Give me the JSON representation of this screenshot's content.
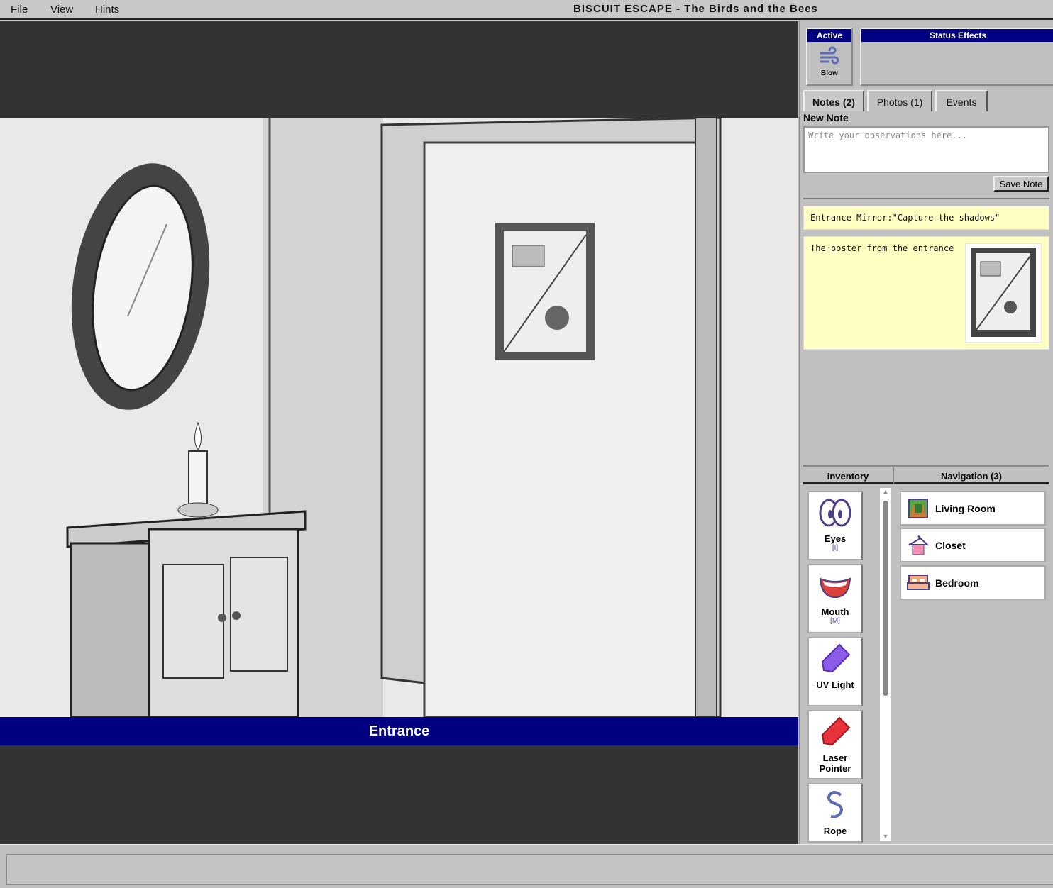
{
  "menu": {
    "items": [
      "File",
      "View",
      "Hints"
    ]
  },
  "window": {
    "title": "BISCUIT ESCAPE - The Birds and the Bees"
  },
  "scene": {
    "location": "Entrance"
  },
  "active": {
    "header": "Active",
    "items": [
      {
        "label": "Blow",
        "icon": "wind-icon"
      }
    ]
  },
  "status": {
    "header": "Status Effects"
  },
  "tabs": [
    {
      "label": "Notes (2)",
      "active": true
    },
    {
      "label": "Photos (1)"
    },
    {
      "label": "Events"
    }
  ],
  "notes": {
    "new_label": "New Note",
    "placeholder": "Write your observations here...",
    "value": "",
    "save_label": "Save Note",
    "entries": [
      {
        "text": "Entrance Mirror:\"Capture the shadows\""
      },
      {
        "text": "The poster from the entrance",
        "has_photo": true
      }
    ]
  },
  "inventory": {
    "header": "Inventory",
    "items": [
      {
        "label": "Eyes",
        "key": "[I]"
      },
      {
        "label": "Mouth",
        "key": "[M]"
      },
      {
        "label": "UV Light"
      },
      {
        "label": "Laser Pointer"
      },
      {
        "label": "Rope"
      }
    ]
  },
  "navigation": {
    "header": "Navigation (3)",
    "items": [
      {
        "label": "Living Room"
      },
      {
        "label": "Closet"
      },
      {
        "label": "Bedroom"
      }
    ]
  },
  "colors": {
    "accent": "#000080",
    "note_bg": "#ffffc4",
    "panel_bg": "#c0c0c0",
    "scene_bg": "#333333"
  }
}
